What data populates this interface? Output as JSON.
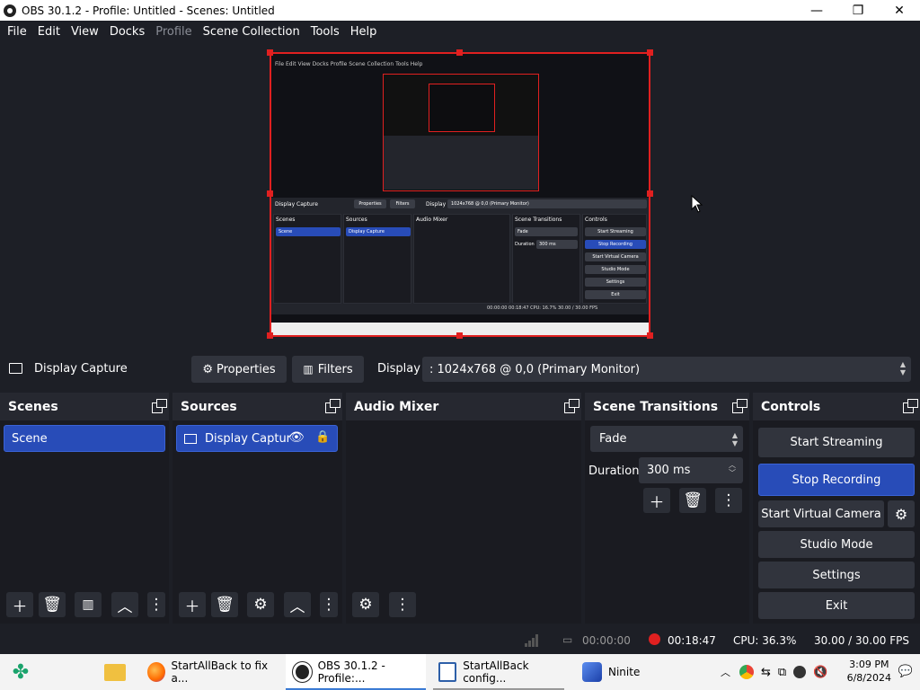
{
  "window": {
    "title": "OBS 30.1.2 - Profile: Untitled - Scenes: Untitled",
    "min": "—",
    "max": "❐",
    "close": "✕"
  },
  "menu": [
    "File",
    "Edit",
    "View",
    "Docks",
    "Profile",
    "Scene Collection",
    "Tools",
    "Help"
  ],
  "preview_mini": {
    "menubar": "File  Edit  View  Docks  Profile  Scene Collection  Tools  Help",
    "source_name": "Display Capture",
    "properties": "Properties",
    "filters": "Filters",
    "display": "Display",
    "display_value": "1024x768 @ 0,0 (Primary Monitor)",
    "scenes": "Scenes",
    "sources": "Sources",
    "audio_mixer": "Audio Mixer",
    "scene_transitions": "Scene Transitions",
    "controls": "Controls",
    "scene": "Scene",
    "display_capture": "Display Capture",
    "fade": "Fade",
    "duration": "Duration",
    "duration_value": "300 ms",
    "start_streaming": "Start Streaming",
    "stop_recording": "Stop Recording",
    "start_virtual_camera": "Start Virtual Camera",
    "studio_mode": "Studio Mode",
    "settings": "Settings",
    "exit": "Exit",
    "status": "00:00:00   00:18:47   CPU: 16.7%   30.00 / 30.00 FPS"
  },
  "source_toolbar": {
    "source_name": "Display Capture",
    "properties": "Properties",
    "filters": "Filters",
    "display_label": "Display",
    "display_value": ": 1024x768 @ 0,0 (Primary Monitor)"
  },
  "scenes": {
    "title": "Scenes",
    "items": [
      "Scene"
    ]
  },
  "sources": {
    "title": "Sources",
    "items": [
      "Display Captur"
    ]
  },
  "audio_mixer": {
    "title": "Audio Mixer"
  },
  "transitions": {
    "title": "Scene Transitions",
    "type": "Fade",
    "duration_label": "Duration",
    "duration_value": "300 ms"
  },
  "controls": {
    "title": "Controls",
    "start_streaming": "Start Streaming",
    "stop_recording": "Stop Recording",
    "start_virtual_camera": "Start Virtual Camera",
    "studio_mode": "Studio Mode",
    "settings": "Settings",
    "exit": "Exit"
  },
  "status": {
    "stream_time": "00:00:00",
    "record_time": "00:18:47",
    "cpu": "CPU: 36.3%",
    "fps": "30.00 / 30.00 FPS"
  },
  "taskbar": {
    "items": [
      {
        "label": "StartAllBack to fix a..."
      },
      {
        "label": "OBS 30.1.2 - Profile:..."
      },
      {
        "label": "StartAllBack config..."
      },
      {
        "label": "Ninite"
      }
    ],
    "time": "3:09 PM",
    "date": "6/8/2024"
  },
  "colors": {
    "accent": "#284cb8",
    "selection": "#e02020",
    "background": "#1d1f26",
    "record": "#e02020"
  }
}
